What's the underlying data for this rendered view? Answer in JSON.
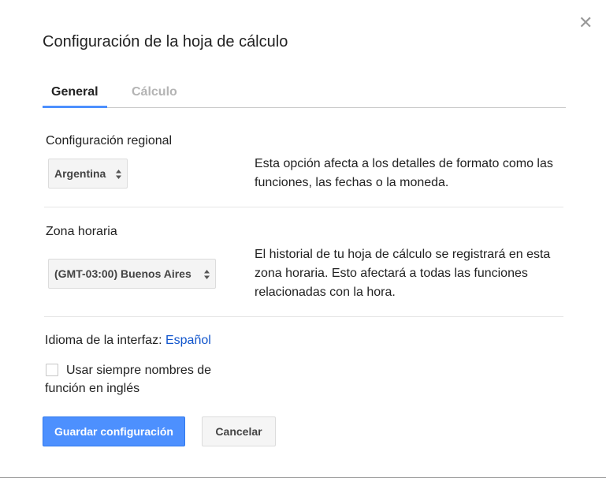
{
  "dialog": {
    "title": "Configuración de la hoja de cálculo",
    "close_icon": "close-icon"
  },
  "tabs": [
    {
      "label": "General",
      "active": true
    },
    {
      "label": "Cálculo",
      "active": false
    }
  ],
  "locale": {
    "label": "Configuración regional",
    "value": "Argentina",
    "description": "Esta opción afecta a los detalles de formato como las funciones, las fechas o la moneda."
  },
  "timezone": {
    "label": "Zona horaria",
    "value": "(GMT-03:00) Buenos Aires",
    "description": "El historial de tu hoja de cálculo se registrará en esta zona horaria. Esto afectará a todas las funciones relacionadas con la hora."
  },
  "language": {
    "label": "Idioma de la interfaz:",
    "value": "Español"
  },
  "english_functions": {
    "label": "Usar siempre nombres de función en inglés",
    "checked": false
  },
  "buttons": {
    "save": "Guardar configuración",
    "cancel": "Cancelar"
  },
  "colors": {
    "primary_button": "#4d90fe",
    "link": "#1155cc",
    "tab_underline": "#4d90fe"
  }
}
